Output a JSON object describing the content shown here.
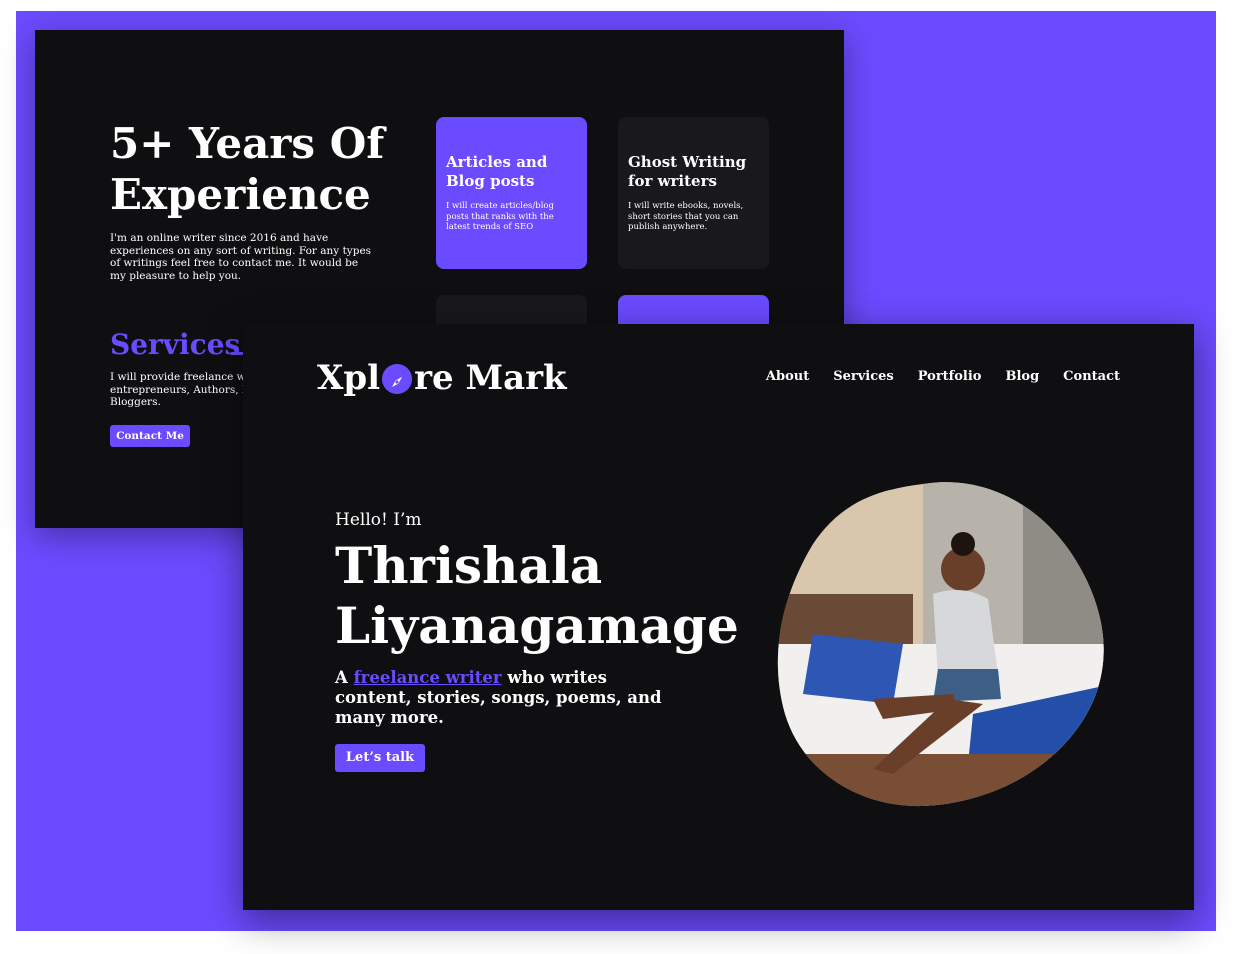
{
  "back_page": {
    "title": "5+ Years Of Experience",
    "intro": "I'm an online writer since 2016 and have experiences on any sort of writing. For any types of writings feel free to contact me. It would be my pleasure to help you.",
    "services_title": "Services",
    "services_text": "I will provide freelance wri\nentrepreneurs, Authors, Di\nBloggers.",
    "contact_label": "Contact Me",
    "cards": [
      {
        "title": "Articles and Blog posts",
        "text": "I will create articles/blog posts that ranks with the latest trends of SEO"
      },
      {
        "title": "Ghost Writing for writers",
        "text": "I will write ebooks, novels, short stories that you can publish anywhere."
      }
    ]
  },
  "front_page": {
    "logo_left": "Xpl",
    "logo_right": "re Mark",
    "logo_icon": "compass-icon",
    "nav": [
      "About",
      "Services",
      "Portfolio",
      "Blog",
      "Contact"
    ],
    "greeting": "Hello! I’m",
    "name": "Thrishala Liyanagamage",
    "tagline_prefix": "A",
    "tagline_link": "freelance writer",
    "tagline_suffix": "who writes content, stories, songs, poems, and many more.",
    "cta_label": "Let’s talk"
  },
  "colors": {
    "accent": "#6b4bff",
    "background": "#0f0f12",
    "card_dark": "#19191d",
    "text": "#ffffff"
  }
}
